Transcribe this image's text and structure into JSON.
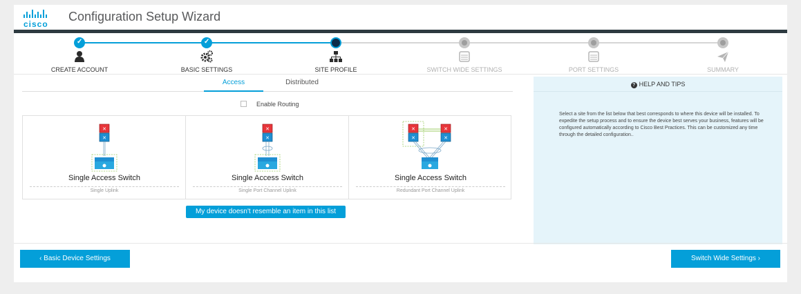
{
  "header": {
    "logo_text": "cisco",
    "title": "Configuration Setup Wizard"
  },
  "stepper": {
    "steps": [
      {
        "label": "CREATE ACCOUNT",
        "state": "done",
        "icon": "user-icon"
      },
      {
        "label": "BASIC SETTINGS",
        "state": "done",
        "icon": "gears-icon"
      },
      {
        "label": "SITE PROFILE",
        "state": "current",
        "icon": "sitemap-icon"
      },
      {
        "label": "SWITCH WIDE SETTINGS",
        "state": "future",
        "icon": "switch-icon"
      },
      {
        "label": "PORT SETTINGS",
        "state": "future",
        "icon": "switch-icon"
      },
      {
        "label": "SUMMARY",
        "state": "future",
        "icon": "paper-plane-icon"
      }
    ]
  },
  "tabs": {
    "access": "Access",
    "distributed": "Distributed",
    "selected": "Access"
  },
  "routing": {
    "label": "Enable Routing",
    "checked": false
  },
  "cards": [
    {
      "title": "Single Access Switch",
      "subtitle": "Single Uplink"
    },
    {
      "title": "Single Access Switch",
      "subtitle": "Single Port Channel Uplink"
    },
    {
      "title": "Single Access Switch",
      "subtitle": "Redundant Port Channel Uplink"
    }
  ],
  "no_match_button": "My device doesn't resemble an item in this list",
  "help": {
    "title": "HELP AND TIPS",
    "text": "Select a site from the list below that best corresponds to where this device will be installed. To expedite the setup process and to ensure the device best serves your business, features will be configured automatically according to Cisco Best Practices. This can be customized any time through the detailed configuration.."
  },
  "footer": {
    "back_label": "‹ Basic Device Settings",
    "next_label": "Switch Wide Settings ›"
  },
  "colors": {
    "accent": "#049fd9",
    "header_bar": "#2d3a40",
    "help_bg": "#e5f4fa"
  }
}
